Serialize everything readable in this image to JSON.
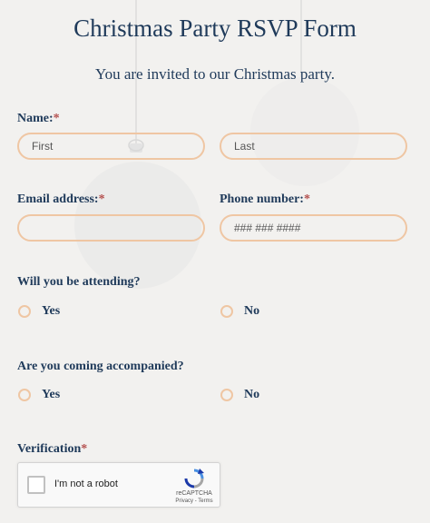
{
  "form": {
    "title": "Christmas Party RSVP Form",
    "subtitle": "You are invited to our Christmas party.",
    "required_mark": "*",
    "name": {
      "label": "Name:",
      "first_placeholder": "First",
      "last_placeholder": "Last",
      "first_value": "",
      "last_value": ""
    },
    "email": {
      "label": "Email address:",
      "placeholder": "",
      "value": ""
    },
    "phone": {
      "label": "Phone number:",
      "placeholder": "### ### ####",
      "value": ""
    },
    "attending": {
      "label": "Will you be attending?",
      "options": [
        "Yes",
        "No"
      ],
      "selected": null
    },
    "accompanied": {
      "label": "Are you coming accompanied?",
      "options": [
        "Yes",
        "No"
      ],
      "selected": null
    },
    "verification": {
      "label": "Verification",
      "captcha_text": "I'm not a robot",
      "captcha_brand": "reCAPTCHA",
      "captcha_links": "Privacy - Terms",
      "checked": false
    }
  },
  "colors": {
    "heading": "#1f3a5a",
    "field_border": "#efc6a3",
    "required": "#b4504e",
    "background": "#f2f1ef"
  },
  "icons": {
    "background_ornaments": "christmas-bauble-icon",
    "captcha_logo": "recaptcha-logo-icon"
  }
}
